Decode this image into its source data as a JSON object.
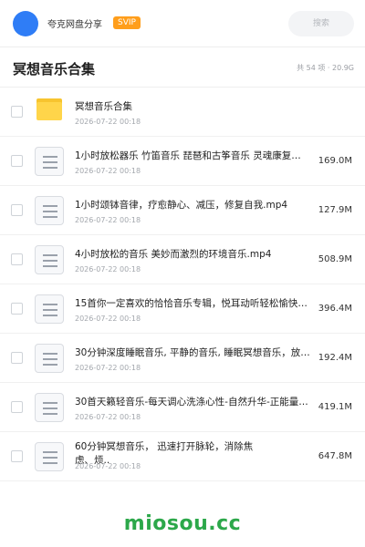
{
  "header": {
    "user_name": "夸克网盘分享",
    "badge": "SVIP",
    "search_placeholder": "搜索",
    "avatar_color": "#2f7df6"
  },
  "folder": {
    "title": "冥想音乐合集",
    "stats": "共 54 项 · 20.9G"
  },
  "items": [
    {
      "type": "folder",
      "name": "冥想音乐合集",
      "date": "2026-07-22 00:18",
      "size": ""
    },
    {
      "type": "file",
      "name": "1小时放松器乐 竹笛音乐  琵琶和古筝音乐 灵魂康复、减压",
      "date": "2026-07-22 00:18",
      "size": "169.0M"
    },
    {
      "type": "file",
      "name": "1小时颂钵音律，疗愈静心、减压，修复自我.mp4",
      "date": "2026-07-22 00:18",
      "size": "127.9M"
    },
    {
      "type": "file",
      "name": "4小时放松的音乐 美妙而激烈的环境音乐.mp4",
      "date": "2026-07-22 00:18",
      "size": "508.9M"
    },
    {
      "type": "file",
      "name": "15首你一定喜欢的恰恰音乐专辑，悦耳动听轻松愉快，舒缓身心",
      "date": "2026-07-22 00:18",
      "size": "396.4M"
    },
    {
      "type": "file",
      "name": "30分钟深度睡眠音乐, 平静的音乐, 睡眠冥想音乐，放松音乐",
      "date": "2026-07-22 00:18",
      "size": "192.4M"
    },
    {
      "type": "file",
      "name": "30首天籁轻音乐-每天调心洗涤心性-自然升华-正能量音乐",
      "date": "2026-07-22 00:18",
      "size": "419.1M"
    },
    {
      "type": "file",
      "name": "60分钟冥想音乐， 迅速打开脉轮，消除焦虑、烦..",
      "date": "2026-07-22 00:18",
      "size": "647.8M"
    }
  ],
  "watermark": "miosou.cc",
  "colors": {
    "accent": "#2f7df6",
    "badge": "#ff9e1b",
    "folder": "#ffd54a",
    "watermark": "#2ca84a"
  }
}
